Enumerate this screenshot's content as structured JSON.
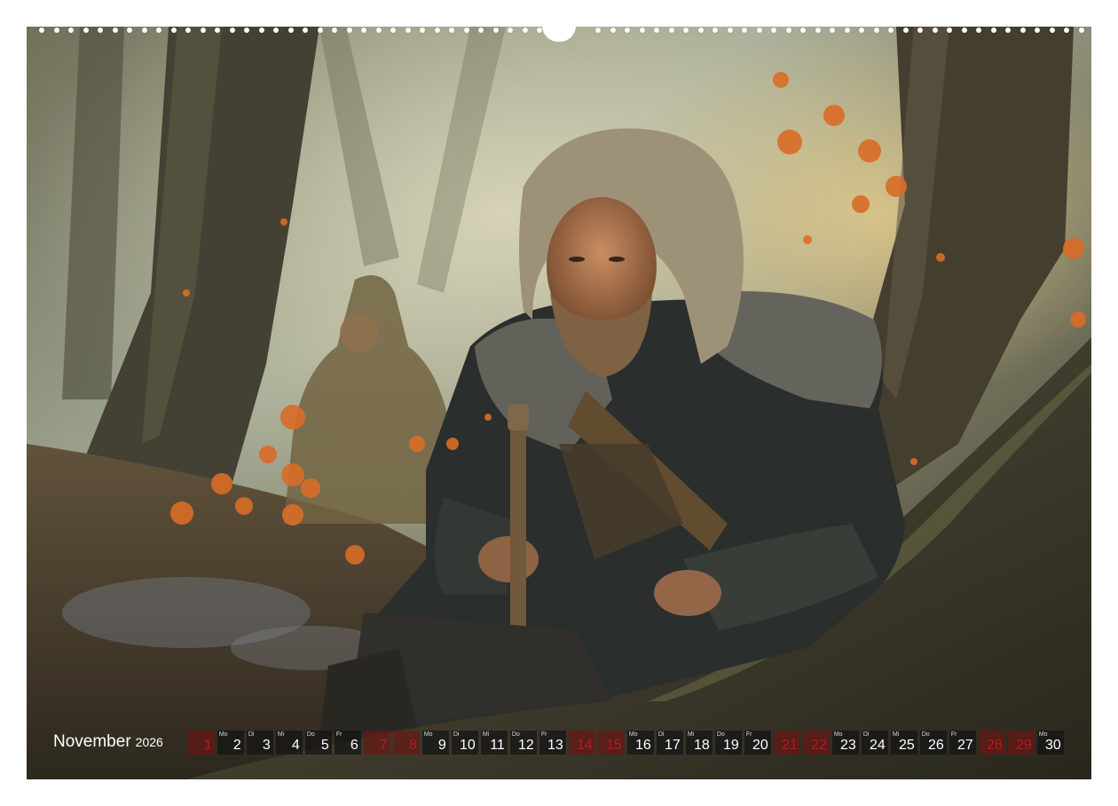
{
  "calendar": {
    "month": "November",
    "year": "2026",
    "days": [
      {
        "day": "1",
        "weekday": "",
        "weekend": true
      },
      {
        "day": "2",
        "weekday": "Mo",
        "weekend": false
      },
      {
        "day": "3",
        "weekday": "Di",
        "weekend": false
      },
      {
        "day": "4",
        "weekday": "Mi",
        "weekend": false
      },
      {
        "day": "5",
        "weekday": "Do",
        "weekend": false
      },
      {
        "day": "6",
        "weekday": "Fr",
        "weekend": false
      },
      {
        "day": "7",
        "weekday": "",
        "weekend": true
      },
      {
        "day": "8",
        "weekday": "",
        "weekend": true
      },
      {
        "day": "9",
        "weekday": "Mo",
        "weekend": false
      },
      {
        "day": "10",
        "weekday": "Di",
        "weekend": false
      },
      {
        "day": "11",
        "weekday": "Mi",
        "weekend": false
      },
      {
        "day": "12",
        "weekday": "Do",
        "weekend": false
      },
      {
        "day": "13",
        "weekday": "Fr",
        "weekend": false
      },
      {
        "day": "14",
        "weekday": "",
        "weekend": true
      },
      {
        "day": "15",
        "weekday": "",
        "weekend": true
      },
      {
        "day": "16",
        "weekday": "Mo",
        "weekend": false
      },
      {
        "day": "17",
        "weekday": "Di",
        "weekend": false
      },
      {
        "day": "18",
        "weekday": "Mi",
        "weekend": false
      },
      {
        "day": "19",
        "weekday": "Do",
        "weekend": false
      },
      {
        "day": "20",
        "weekday": "Fr",
        "weekend": false
      },
      {
        "day": "21",
        "weekday": "",
        "weekend": true
      },
      {
        "day": "22",
        "weekday": "",
        "weekend": true
      },
      {
        "day": "23",
        "weekday": "Mo",
        "weekend": false
      },
      {
        "day": "24",
        "weekday": "Di",
        "weekend": false
      },
      {
        "day": "25",
        "weekday": "Mi",
        "weekend": false
      },
      {
        "day": "26",
        "weekday": "Do",
        "weekend": false
      },
      {
        "day": "27",
        "weekday": "Fr",
        "weekend": false
      },
      {
        "day": "28",
        "weekday": "",
        "weekend": true
      },
      {
        "day": "29",
        "weekday": "",
        "weekend": true
      },
      {
        "day": "30",
        "weekday": "Mo",
        "weekend": false
      }
    ]
  },
  "colors": {
    "weekend_number": "#b21c1c",
    "weekday_number": "#ffffff",
    "cell_background": "#141414"
  }
}
